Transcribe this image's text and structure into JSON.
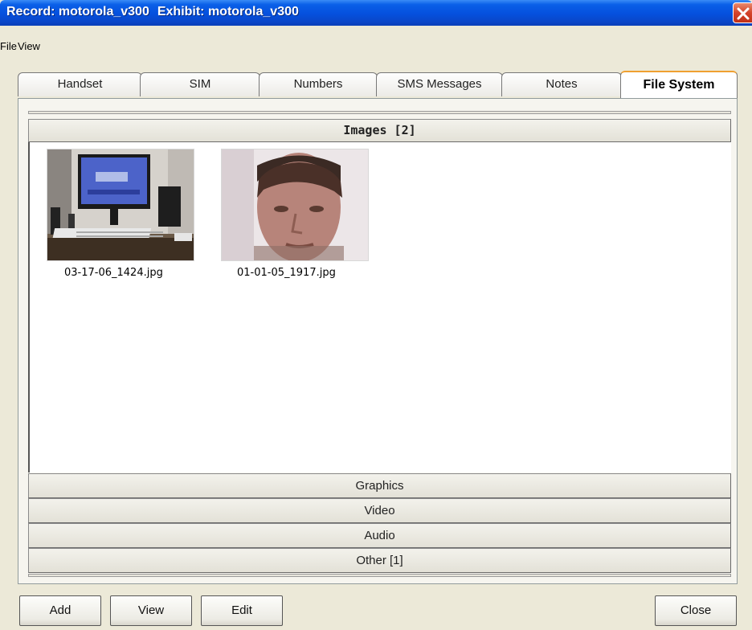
{
  "window": {
    "title_record": "Record: motorola_v300",
    "title_exhibit": "Exhibit: motorola_v300",
    "close_icon": "close-icon"
  },
  "menu": {
    "items": [
      "File",
      "View"
    ]
  },
  "tabs": [
    {
      "label": "Handset"
    },
    {
      "label": "SIM"
    },
    {
      "label": "Numbers"
    },
    {
      "label": "SMS Messages"
    },
    {
      "label": "Notes"
    },
    {
      "label": "File System",
      "active": true
    }
  ],
  "sections": {
    "images": "Images [2]",
    "graphics": "Graphics",
    "video": "Video",
    "audio": "Audio",
    "other": "Other [1]"
  },
  "images": [
    {
      "filename": "03-17-06_1424.jpg"
    },
    {
      "filename": "01-01-05_1917.jpg"
    }
  ],
  "buttons": {
    "add": "Add",
    "view": "View",
    "edit": "Edit",
    "close": "Close"
  }
}
